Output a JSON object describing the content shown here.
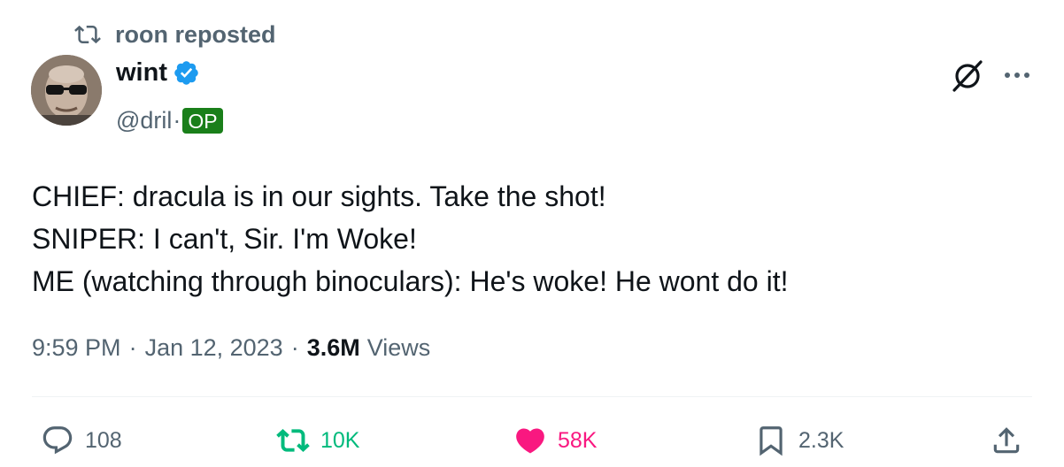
{
  "repost": {
    "icon": "repost-icon",
    "label": "roon reposted"
  },
  "author": {
    "display_name": "wint",
    "handle": "@dril",
    "separator": "·",
    "badge": "OP",
    "verified_icon": "verified-badge-icon",
    "avatar": "avatar"
  },
  "top_actions": {
    "slash_icon": "slash-circle-icon",
    "more_icon": "more-options-icon"
  },
  "tweet": {
    "lines": [
      "CHIEF: dracula is in our sights. Take the shot!",
      "SNIPER: I can't, Sir. I'm Woke!",
      "ME (watching through binoculars): He's woke! He wont do it!"
    ]
  },
  "meta": {
    "time": "9:59 PM",
    "dot1": "·",
    "date": "Jan 12, 2023",
    "dot2": "·",
    "views_count": "3.6M",
    "views_label": "Views"
  },
  "actions": {
    "reply_count": "108",
    "repost_count": "10K",
    "like_count": "58K",
    "bookmark_count": "2.3K"
  },
  "colors": {
    "text_primary": "#0f1419",
    "text_secondary": "#536471",
    "repost_green": "#00ba7c",
    "like_pink": "#f91880",
    "verified_blue": "#1d9bf0",
    "op_badge_green": "#1a7f1a",
    "divider": "#eff3f4"
  }
}
